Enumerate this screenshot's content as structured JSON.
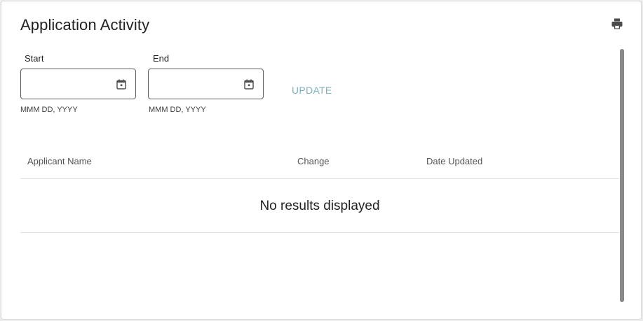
{
  "card": {
    "title": "Application Activity",
    "print_icon": "print-icon"
  },
  "filters": {
    "start": {
      "label": "Start",
      "value": "",
      "placeholder": "",
      "hint": "MMM DD, YYYY",
      "icon": "calendar-icon"
    },
    "end": {
      "label": "End",
      "value": "",
      "placeholder": "",
      "hint": "MMM DD, YYYY",
      "icon": "calendar-icon"
    },
    "update_label": "UPDATE"
  },
  "table": {
    "columns": [
      "Applicant Name",
      "Change",
      "Date Updated"
    ],
    "empty_message": "No results displayed"
  },
  "colors": {
    "accent": "#7fb3bf",
    "border": "#5c5c5c",
    "scrollbar": "#8a8a8a"
  }
}
